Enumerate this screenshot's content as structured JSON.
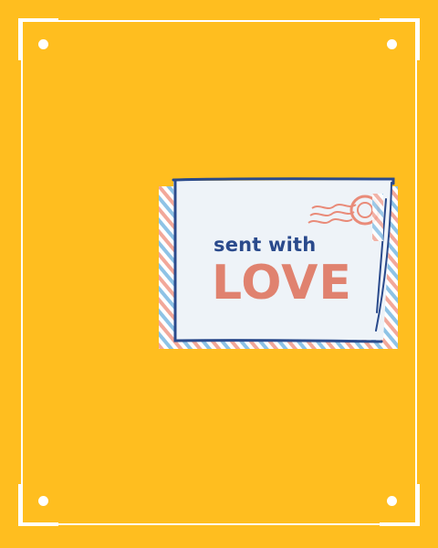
{
  "card": {
    "line1": "sent with",
    "line2": "LOVE"
  },
  "icons": [
    "postmark-stamp-icon",
    "corner-dot-icon"
  ],
  "colors": {
    "background": "#FFBE1F",
    "frame": "#FFFFFF",
    "ink_blue": "#2A4A8C",
    "love_coral": "#E0826F",
    "envelope_paper": "#EEF3F8",
    "airmail_stripe_blue": "#8EC3E6",
    "airmail_stripe_red": "#F2A89A"
  }
}
